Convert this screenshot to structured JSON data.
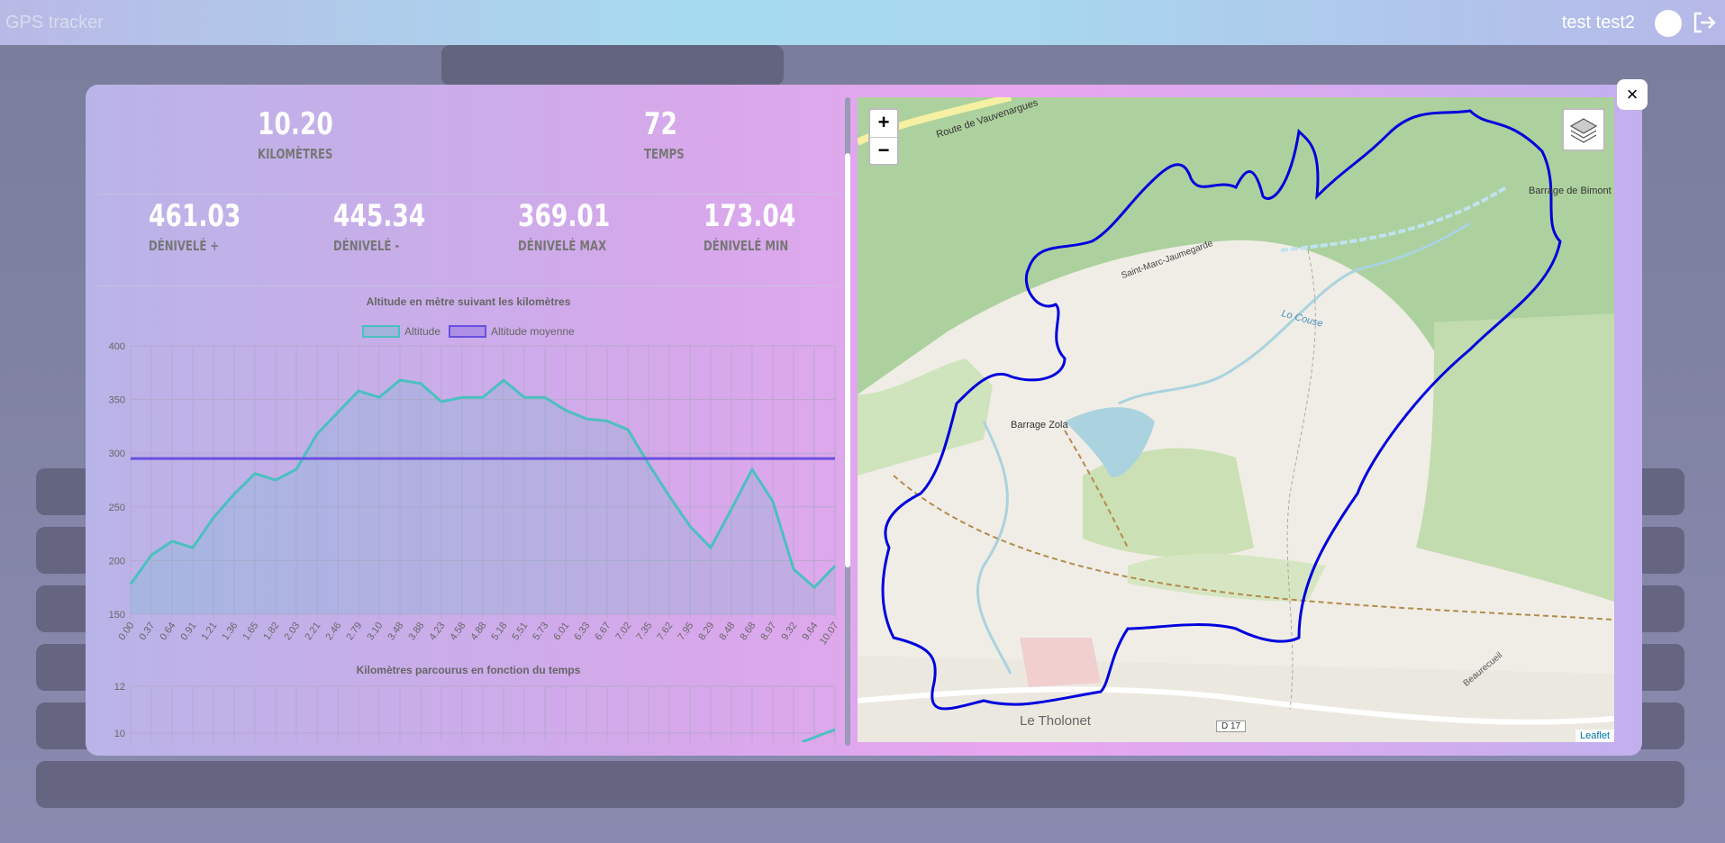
{
  "header": {
    "brand": "GPS tracker",
    "user_name": "test test2",
    "logout_icon": "logout-icon"
  },
  "modal": {
    "close_label": "×",
    "top_stats": [
      {
        "value": "10.20",
        "label": "KILOMÈTRES"
      },
      {
        "value": "72",
        "label": "TEMPS"
      }
    ],
    "bottom_stats": [
      {
        "value": "461.03",
        "label": "DÉNIVELÉ +"
      },
      {
        "value": "445.34",
        "label": "DÉNIVELÉ -"
      },
      {
        "value": "369.01",
        "label": "DÉNIVELÉ MAX"
      },
      {
        "value": "173.04",
        "label": "DÉNIVELÉ MIN"
      }
    ]
  },
  "chart_data": [
    {
      "type": "line",
      "title": "Altitude en mètre suivant les kilomètres",
      "xlabel": "",
      "ylabel": "",
      "ylim": [
        150,
        400
      ],
      "yticks": [
        150,
        200,
        250,
        300,
        350,
        400
      ],
      "grid": true,
      "legend": "top-center",
      "colors": {
        "altitude": "#4bc0c0",
        "average": "#6a4fe0"
      },
      "categories": [
        "0.00",
        "0.37",
        "0.64",
        "0.91",
        "1.21",
        "1.36",
        "1.65",
        "1.82",
        "2.03",
        "2.21",
        "2.46",
        "2.79",
        "3.10",
        "3.48",
        "3.88",
        "4.23",
        "4.58",
        "4.88",
        "5.18",
        "5.51",
        "5.73",
        "6.01",
        "6.33",
        "6.67",
        "7.02",
        "7.35",
        "7.62",
        "7.95",
        "8.29",
        "8.48",
        "8.68",
        "8.97",
        "9.32",
        "9.64",
        "10.07"
      ],
      "series": [
        {
          "name": "Altitude",
          "values": [
            178,
            205,
            218,
            212,
            240,
            262,
            281,
            275,
            285,
            318,
            338,
            358,
            352,
            368,
            365,
            348,
            352,
            352,
            368,
            352,
            352,
            340,
            332,
            330,
            322,
            290,
            260,
            232,
            212,
            248,
            285,
            255,
            192,
            175,
            195
          ]
        },
        {
          "name": "Altitude moyenne",
          "values": [
            295,
            295,
            295,
            295,
            295,
            295,
            295,
            295,
            295,
            295,
            295,
            295,
            295,
            295,
            295,
            295,
            295,
            295,
            295,
            295,
            295,
            295,
            295,
            295,
            295,
            295,
            295,
            295,
            295,
            295,
            295,
            295,
            295,
            295,
            295
          ]
        }
      ]
    },
    {
      "type": "line",
      "title": "Kilomètres parcourus en fonction du temps",
      "xlabel": "",
      "ylabel": "",
      "ylim": [
        0,
        12
      ],
      "yticks": [
        10,
        12
      ],
      "grid": true
    }
  ],
  "map": {
    "zoom_in": "+",
    "zoom_out": "−",
    "attribution": "Leaflet",
    "labels": [
      "Route de Vauvenargues",
      "Barrage de Bimont",
      "Saint-Marc-Jaumegarde",
      "Lo Couse",
      "Barrage Zola",
      "Le Tholonet",
      "D 17",
      "Beaurecueil"
    ]
  }
}
